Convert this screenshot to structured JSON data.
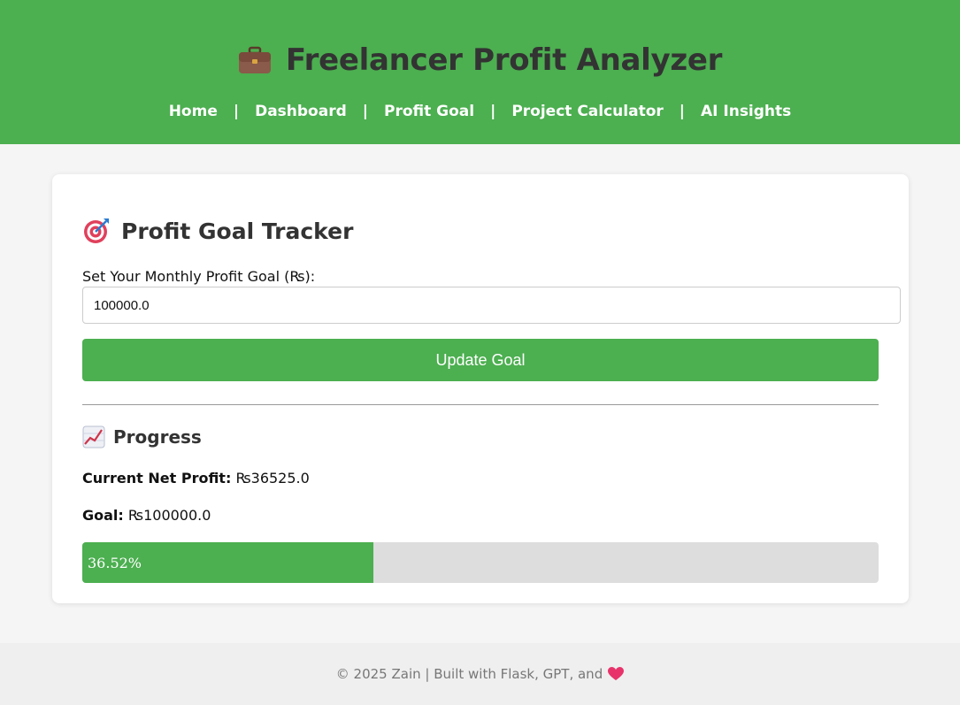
{
  "header": {
    "title": "Freelancer Profit Analyzer",
    "icon": "briefcase-icon",
    "brand_color": "#4caf50",
    "nav": [
      {
        "label": "Home"
      },
      {
        "label": "Dashboard"
      },
      {
        "label": "Profit Goal"
      },
      {
        "label": "Project Calculator"
      },
      {
        "label": "AI Insights"
      }
    ],
    "separator": "|"
  },
  "main": {
    "heading": "Profit Goal Tracker",
    "heading_icon": "target-icon",
    "goal_label": "Set Your Monthly Profit Goal (₨):",
    "goal_value": "100000.0",
    "update_button": "Update Goal",
    "progress_heading": "Progress",
    "progress_icon": "chart-increasing-icon",
    "current_profit_label": "Current Net Profit:",
    "current_profit_value": "₨36525.0",
    "goal_summary_label": "Goal:",
    "goal_summary_value": "₨100000.0",
    "progress_percent_text": "36.52%",
    "progress_fraction": 0.3652
  },
  "footer": {
    "text": "© 2025 Zain | Built with Flask, GPT, and",
    "icon": "heart-icon"
  }
}
